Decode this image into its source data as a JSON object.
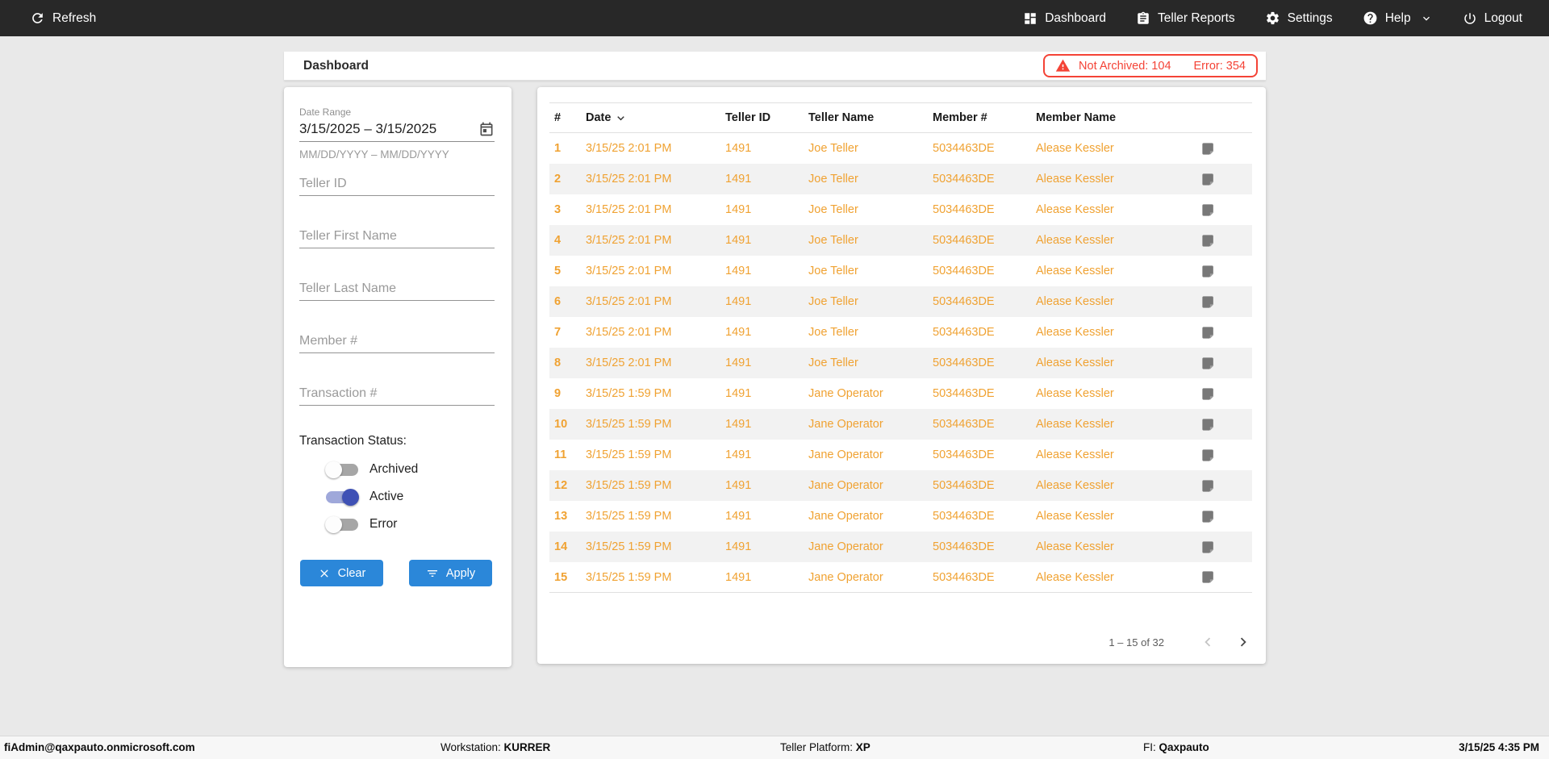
{
  "colors": {
    "nav_bg": "#282828",
    "accent_blue": "#2b87d9",
    "row_orange": "#f0a232",
    "alert_red": "#f44336",
    "toggle_on": "#3f51b5"
  },
  "nav": {
    "refresh": {
      "label": "Refresh"
    },
    "items": [
      {
        "label": "Dashboard"
      },
      {
        "label": "Teller Reports"
      },
      {
        "label": "Settings"
      },
      {
        "label": "Help"
      },
      {
        "label": "Logout"
      }
    ]
  },
  "header": {
    "title": "Dashboard",
    "alert": {
      "not_archived": "Not Archived: 104",
      "error": "Error: 354"
    }
  },
  "filters": {
    "date_range": {
      "label": "Date Range",
      "value": "3/15/2025 – 3/15/2025",
      "helper": "MM/DD/YYYY – MM/DD/YYYY"
    },
    "fields": [
      {
        "placeholder": "Teller ID"
      },
      {
        "placeholder": "Teller First Name"
      },
      {
        "placeholder": "Teller Last Name"
      },
      {
        "placeholder": "Member #"
      },
      {
        "placeholder": "Transaction #"
      }
    ],
    "status": {
      "label": "Transaction Status:",
      "toggles": [
        {
          "label": "Archived",
          "on": false
        },
        {
          "label": "Active",
          "on": true
        },
        {
          "label": "Error",
          "on": false
        }
      ]
    },
    "clear_label": "Clear",
    "apply_label": "Apply"
  },
  "table": {
    "columns": {
      "num": "#",
      "date": "Date",
      "teller_id": "Teller ID",
      "teller_name": "Teller Name",
      "member": "Member #",
      "member_name": "Member Name"
    },
    "sort_column": "Date",
    "rows": [
      {
        "num": "1",
        "date": "3/15/25 2:01 PM",
        "teller_id": "1491",
        "teller_name": "Joe Teller",
        "member": "5034463DE",
        "member_name": "Alease Kessler"
      },
      {
        "num": "2",
        "date": "3/15/25 2:01 PM",
        "teller_id": "1491",
        "teller_name": "Joe Teller",
        "member": "5034463DE",
        "member_name": "Alease Kessler"
      },
      {
        "num": "3",
        "date": "3/15/25 2:01 PM",
        "teller_id": "1491",
        "teller_name": "Joe Teller",
        "member": "5034463DE",
        "member_name": "Alease Kessler"
      },
      {
        "num": "4",
        "date": "3/15/25 2:01 PM",
        "teller_id": "1491",
        "teller_name": "Joe Teller",
        "member": "5034463DE",
        "member_name": "Alease Kessler"
      },
      {
        "num": "5",
        "date": "3/15/25 2:01 PM",
        "teller_id": "1491",
        "teller_name": "Joe Teller",
        "member": "5034463DE",
        "member_name": "Alease Kessler"
      },
      {
        "num": "6",
        "date": "3/15/25 2:01 PM",
        "teller_id": "1491",
        "teller_name": "Joe Teller",
        "member": "5034463DE",
        "member_name": "Alease Kessler"
      },
      {
        "num": "7",
        "date": "3/15/25 2:01 PM",
        "teller_id": "1491",
        "teller_name": "Joe Teller",
        "member": "5034463DE",
        "member_name": "Alease Kessler"
      },
      {
        "num": "8",
        "date": "3/15/25 2:01 PM",
        "teller_id": "1491",
        "teller_name": "Joe Teller",
        "member": "5034463DE",
        "member_name": "Alease Kessler"
      },
      {
        "num": "9",
        "date": "3/15/25 1:59 PM",
        "teller_id": "1491",
        "teller_name": "Jane Operator",
        "member": "5034463DE",
        "member_name": "Alease Kessler"
      },
      {
        "num": "10",
        "date": "3/15/25 1:59 PM",
        "teller_id": "1491",
        "teller_name": "Jane Operator",
        "member": "5034463DE",
        "member_name": "Alease Kessler"
      },
      {
        "num": "11",
        "date": "3/15/25 1:59 PM",
        "teller_id": "1491",
        "teller_name": "Jane Operator",
        "member": "5034463DE",
        "member_name": "Alease Kessler"
      },
      {
        "num": "12",
        "date": "3/15/25 1:59 PM",
        "teller_id": "1491",
        "teller_name": "Jane Operator",
        "member": "5034463DE",
        "member_name": "Alease Kessler"
      },
      {
        "num": "13",
        "date": "3/15/25 1:59 PM",
        "teller_id": "1491",
        "teller_name": "Jane Operator",
        "member": "5034463DE",
        "member_name": "Alease Kessler"
      },
      {
        "num": "14",
        "date": "3/15/25 1:59 PM",
        "teller_id": "1491",
        "teller_name": "Jane Operator",
        "member": "5034463DE",
        "member_name": "Alease Kessler"
      },
      {
        "num": "15",
        "date": "3/15/25 1:59 PM",
        "teller_id": "1491",
        "teller_name": "Jane Operator",
        "member": "5034463DE",
        "member_name": "Alease Kessler"
      }
    ],
    "pagination": {
      "range": "1 – 15 of 32"
    }
  },
  "statusbar": {
    "user": "fiAdmin@qaxpauto.onmicrosoft.com",
    "workstation_label": "Workstation:",
    "workstation": "KURRER",
    "platform_label": "Teller Platform:",
    "platform": "XP",
    "fi_label": "FI:",
    "fi": "Qaxpauto",
    "datetime": "3/15/25 4:35 PM"
  }
}
